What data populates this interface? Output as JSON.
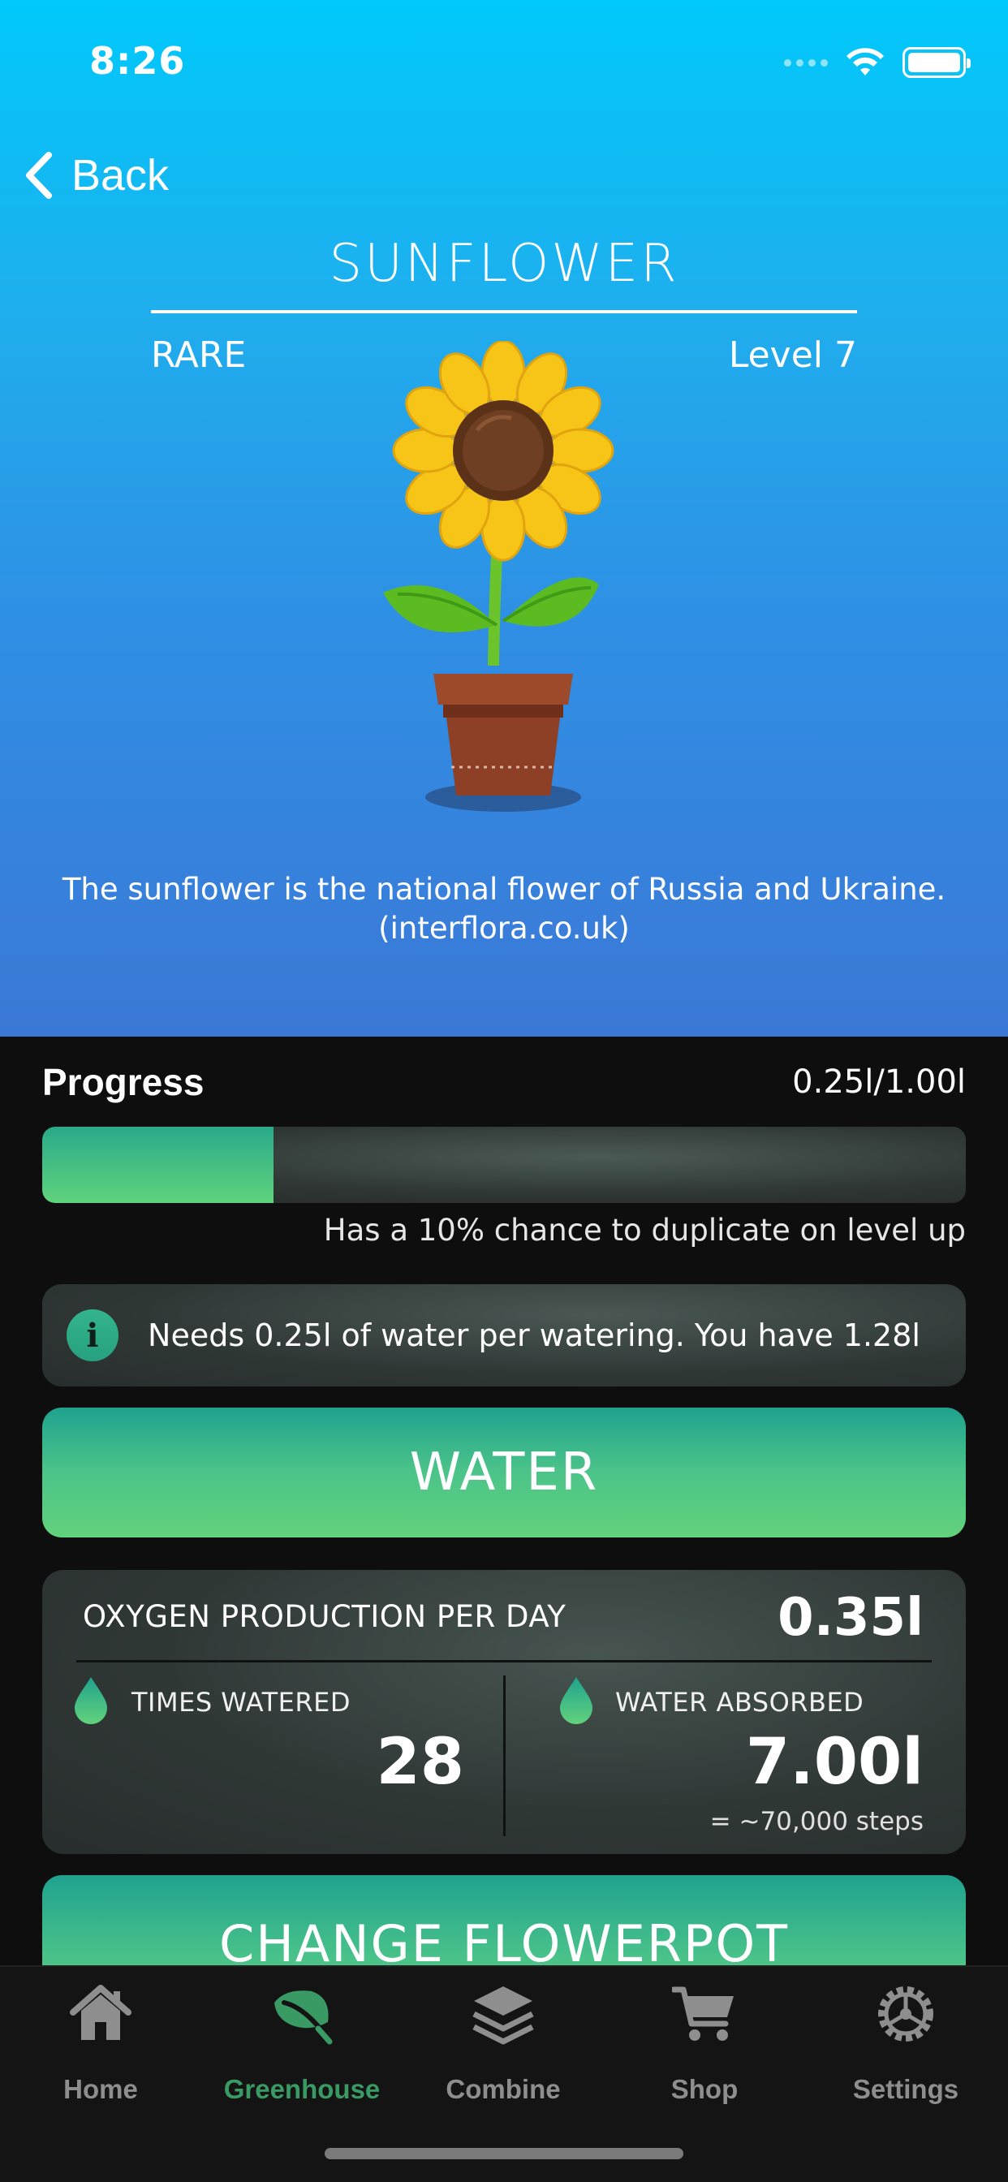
{
  "status_bar": {
    "time": "8:26"
  },
  "nav": {
    "back_label": "Back"
  },
  "plant": {
    "name": "SUNFLOWER",
    "rarity": "RARE",
    "level": "Level 7",
    "fact_line1": "The sunflower is the national flower of Russia and Ukraine.",
    "fact_line2": "(interflora.co.uk)"
  },
  "progress": {
    "label": "Progress",
    "value_text": "0.25l/1.00l",
    "fraction": 0.25,
    "duplicate_note": "Has a 10% chance to duplicate on level up"
  },
  "info": {
    "icon": "info-icon",
    "text": "Needs 0.25l of water per watering. You have 1.28l"
  },
  "water_button": {
    "label": "WATER"
  },
  "stats": {
    "oxygen_label": "OXYGEN PRODUCTION PER DAY",
    "oxygen_value": "0.35l",
    "times_watered_label": "TIMES WATERED",
    "times_watered_value": "28",
    "water_absorbed_label": "WATER ABSORBED",
    "water_absorbed_value": "7.00l",
    "water_absorbed_sub": "= ~70,000 steps"
  },
  "change_button": {
    "label": "CHANGE FLOWERPOT"
  },
  "tabbar": {
    "items": [
      {
        "label": "Home",
        "icon": "home-icon",
        "active": false
      },
      {
        "label": "Greenhouse",
        "icon": "leaf-icon",
        "active": true
      },
      {
        "label": "Combine",
        "icon": "layers-icon",
        "active": false
      },
      {
        "label": "Shop",
        "icon": "cart-icon",
        "active": false
      },
      {
        "label": "Settings",
        "icon": "gear-icon",
        "active": false
      }
    ]
  },
  "colors": {
    "hero_top": "#00c9fb",
    "hero_bottom": "#3b78d6",
    "accent_green": "#5fd37c",
    "active_tab": "#3a9a64"
  }
}
